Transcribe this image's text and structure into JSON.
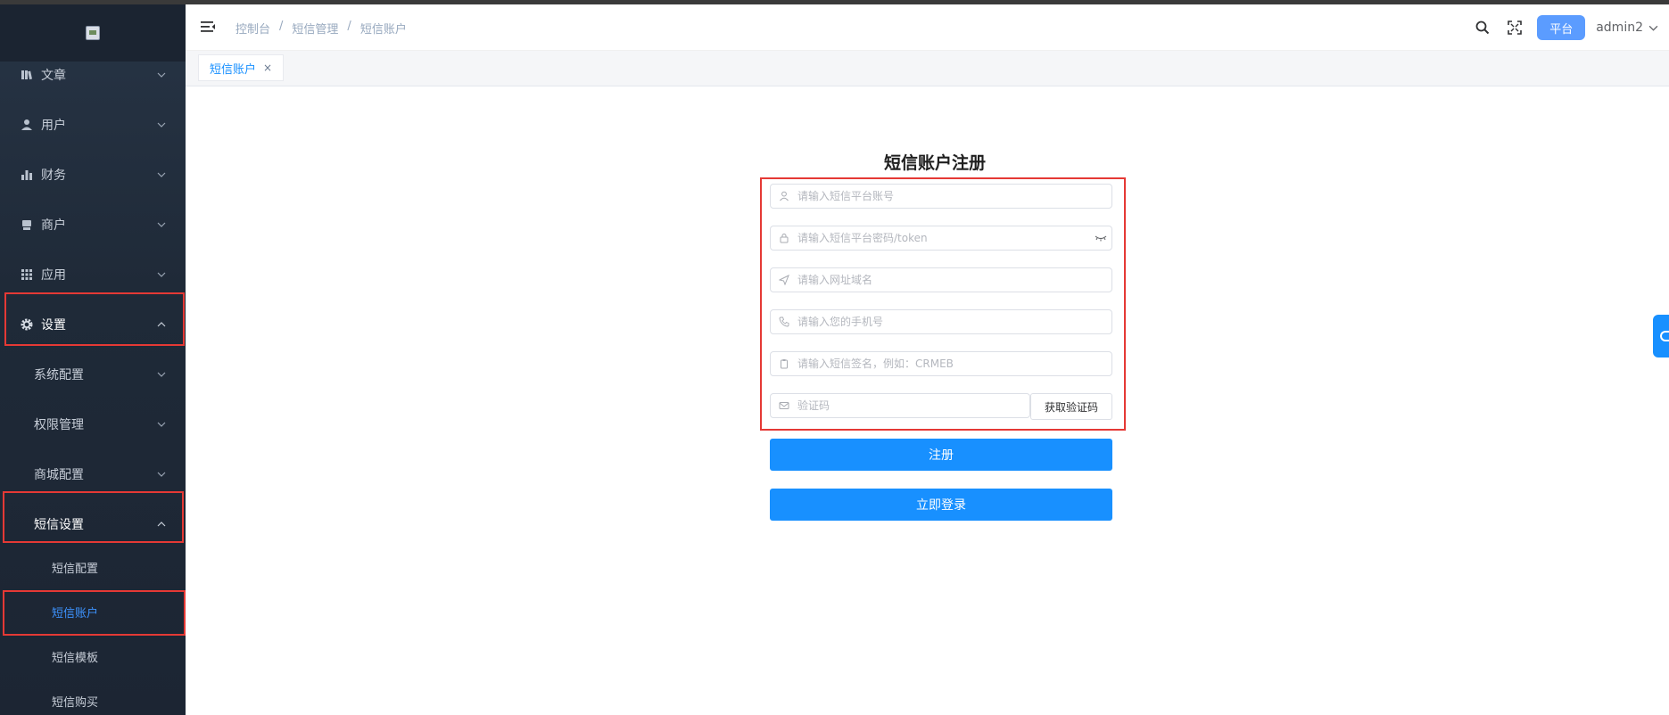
{
  "sidebar": {
    "items": [
      {
        "label": "文章",
        "icon": "book-icon"
      },
      {
        "label": "用户",
        "icon": "user-icon"
      },
      {
        "label": "财务",
        "icon": "bar-chart-icon"
      },
      {
        "label": "商户",
        "icon": "store-icon"
      },
      {
        "label": "应用",
        "icon": "grid-icon"
      },
      {
        "label": "设置",
        "icon": "gear-icon"
      }
    ],
    "sub_items": [
      {
        "label": "系统配置"
      },
      {
        "label": "权限管理"
      },
      {
        "label": "商城配置"
      },
      {
        "label": "短信设置"
      }
    ],
    "sms_items": [
      {
        "label": "短信配置"
      },
      {
        "label": "短信账户"
      },
      {
        "label": "短信模板"
      },
      {
        "label": "短信购买"
      }
    ]
  },
  "header": {
    "breadcrumb": [
      "控制台",
      "短信管理",
      "短信账户"
    ],
    "breadcrumb_sep": "/",
    "platform_label": "平台",
    "username": "admin2"
  },
  "tabs": [
    {
      "label": "短信账户",
      "close": "×"
    }
  ],
  "form": {
    "title": "短信账户注册",
    "account_placeholder": "请输入短信平台账号",
    "password_placeholder": "请输入短信平台密码/token",
    "domain_placeholder": "请输入网址域名",
    "phone_placeholder": "请输入您的手机号",
    "sign_placeholder": "请输入短信签名，例如：CRMEB",
    "code_placeholder": "验证码",
    "get_code_label": "获取验证码",
    "register_label": "注册",
    "login_label": "立即登录"
  },
  "colors": {
    "primary": "#1890ff",
    "sidebar_bg": "#273445",
    "highlight": "#e53935",
    "active_text": "#3d93ff"
  }
}
